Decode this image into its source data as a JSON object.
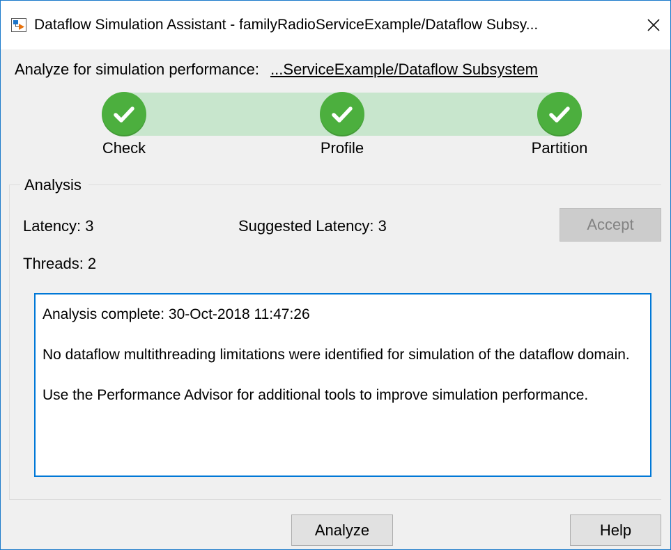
{
  "window": {
    "title": "Dataflow Simulation Assistant - familyRadioServiceExample/Dataflow Subsy...",
    "app_icon": "simulink-icon",
    "close_icon": "close-icon"
  },
  "target": {
    "label": "Analyze for simulation performance:",
    "link": "...ServiceExample/Dataflow Subsystem"
  },
  "steps": [
    {
      "label": "Check",
      "status": "complete",
      "icon": "checkmark-icon"
    },
    {
      "label": "Profile",
      "status": "complete",
      "icon": "checkmark-icon"
    },
    {
      "label": "Partition",
      "status": "complete",
      "icon": "checkmark-icon"
    }
  ],
  "analysis": {
    "group_title": "Analysis",
    "latency": "Latency: 3",
    "suggested_latency": "Suggested Latency: 3",
    "threads": "Threads: 2",
    "accept_label": "Accept",
    "accept_enabled": false,
    "results": [
      "Analysis complete: 30-Oct-2018 11:47:26",
      "No dataflow multithreading limitations were identified for simulation of the dataflow domain.",
      "Use the Performance Advisor for additional tools to improve simulation performance."
    ]
  },
  "buttons": {
    "analyze_label": "Analyze",
    "help_label": "Help"
  },
  "colors": {
    "progress_band": "#c8e6cd",
    "step_complete": "#4caf3e",
    "focus_border": "#0078d7",
    "window_border": "#1979ca"
  }
}
